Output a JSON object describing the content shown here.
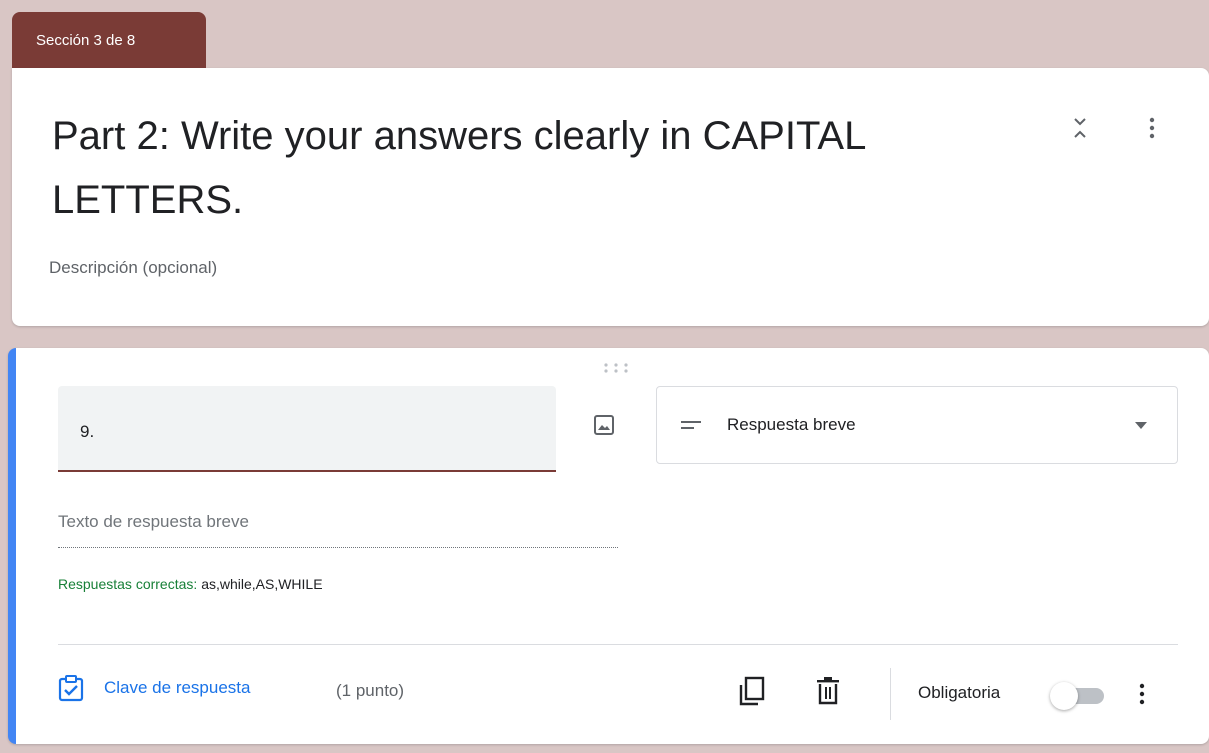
{
  "section_tab": {
    "label": "Sección 3 de 8"
  },
  "section": {
    "title": "Part 2: Write your answers clearly in CAPITAL LETTERS.",
    "description_placeholder": "Descripción (opcional)",
    "icons": [
      "collapse-icon",
      "more-vert-icon"
    ]
  },
  "question": {
    "title": "9.",
    "type": "Respuesta breve",
    "answer_placeholder": "Texto de respuesta breve",
    "correct_label": "Respuestas correctas:",
    "correct_values": "as,while,AS,WHILE",
    "answer_key_label": "Clave de respuesta",
    "points": "(1 punto)",
    "required_label": "Obligatoria",
    "required": false
  },
  "colors": {
    "theme": "#7a3b36",
    "accent": "#4285f4",
    "link": "#1a73e8",
    "correct_label": "#188038"
  }
}
